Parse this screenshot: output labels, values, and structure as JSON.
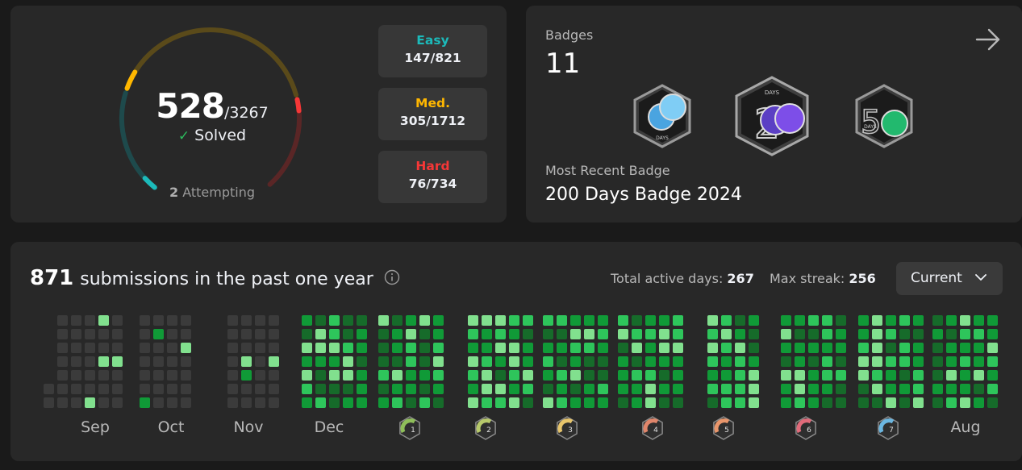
{
  "progress": {
    "solved": "528",
    "total": "/3267",
    "solved_label": "Solved",
    "attempting_count": "2",
    "attempting_label": "Attempting",
    "colors": {
      "easy": "#1cbaba",
      "medium": "#ffb700",
      "hard": "#f63737"
    },
    "difficulties": [
      {
        "name": "Easy",
        "value": "147/821",
        "color": "#1cbaba",
        "solved": 147,
        "total": 821
      },
      {
        "name": "Med.",
        "value": "305/1712",
        "color": "#ffb700",
        "solved": 305,
        "total": 1712
      },
      {
        "name": "Hard",
        "value": "76/734",
        "color": "#f63737",
        "solved": 76,
        "total": 734
      }
    ]
  },
  "badges": {
    "title": "Badges",
    "count": "11",
    "arrow_icon": "arrow-right-icon",
    "recent_label": "Most Recent Badge",
    "recent_name": "200 Days Badge 2024",
    "items": [
      {
        "icon": "100-days-badge-icon",
        "label": "DAYS"
      },
      {
        "icon": "200-days-badge-icon",
        "label": "DAYS"
      },
      {
        "icon": "50-days-badge-icon",
        "label": "DAYS"
      }
    ]
  },
  "submissions": {
    "count": "871",
    "label": "submissions in the past one year",
    "info_icon": "info-icon",
    "active_days_label": "Total active days:",
    "active_days": "267",
    "max_streak_label": "Max streak:",
    "max_streak": "256",
    "selector": "Current",
    "months": [
      "Sep",
      "Oct",
      "Nov",
      "Dec",
      "1",
      "2",
      "3",
      "4",
      "5",
      "6",
      "7",
      "Aug"
    ],
    "month_badge_icons": [
      "jan-badge-icon",
      "feb-badge-icon",
      "mar-badge-icon",
      "apr-badge-icon",
      "may-badge-icon",
      "jun-badge-icon",
      "jul-badge-icon"
    ],
    "month_badge_colors": [
      "#8fbf5a",
      "#b7c96b",
      "#e6c46b",
      "#e0866b",
      "#e9966b",
      "#e06b7a",
      "#6bb6e0"
    ],
    "heat_colors": [
      "#3b3b3b",
      "#166b2a",
      "#109a37",
      "#2ec55b",
      "#81e08e"
    ]
  }
}
